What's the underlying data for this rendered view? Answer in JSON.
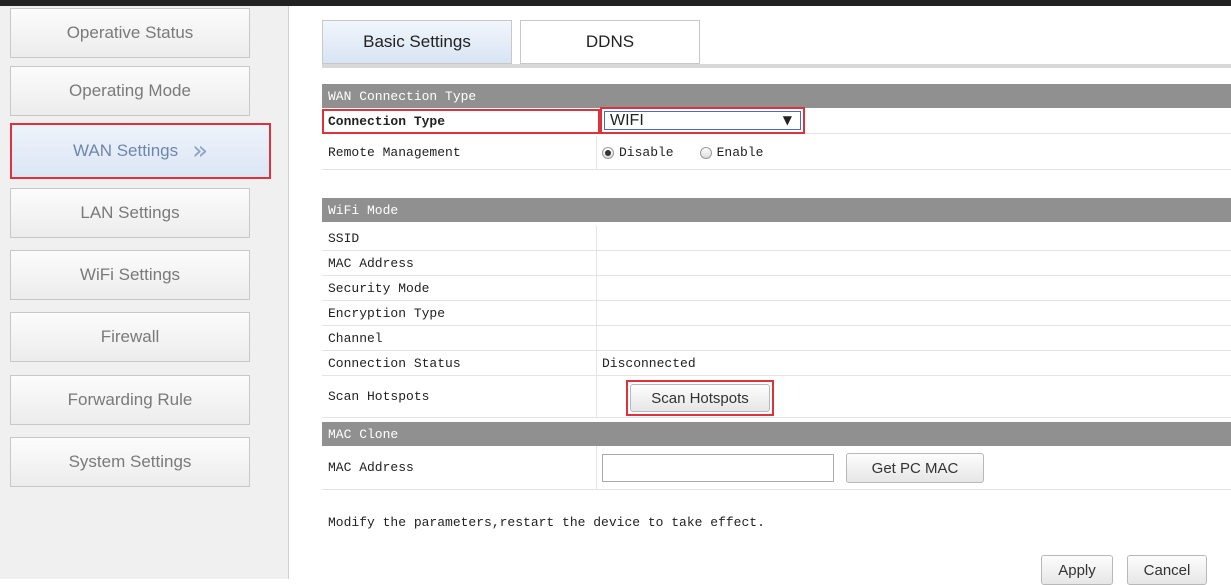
{
  "sidebar": {
    "items": [
      {
        "label": "Operative Status"
      },
      {
        "label": "Operating Mode"
      },
      {
        "label": "WAN Settings",
        "chevron": "»"
      },
      {
        "label": "LAN Settings"
      },
      {
        "label": "WiFi Settings"
      },
      {
        "label": "Firewall"
      },
      {
        "label": "Forwarding Rule"
      },
      {
        "label": "System Settings"
      }
    ]
  },
  "tabs": [
    {
      "label": "Basic Settings"
    },
    {
      "label": "DDNS"
    }
  ],
  "wan": {
    "header": "WAN Connection Type",
    "connection_type_label": "Connection Type",
    "connection_type_value": "WIFI",
    "remote_mgmt_label": "Remote Management",
    "remote_disable": "Disable",
    "remote_enable": "Enable"
  },
  "wifi": {
    "header": "WiFi Mode",
    "rows": [
      {
        "label": "SSID",
        "value": ""
      },
      {
        "label": "MAC Address",
        "value": ""
      },
      {
        "label": "Security Mode",
        "value": ""
      },
      {
        "label": "Encryption Type",
        "value": ""
      },
      {
        "label": "Channel",
        "value": ""
      },
      {
        "label": "Connection Status",
        "value": "Disconnected"
      }
    ],
    "scan_label": "Scan Hotspots",
    "scan_button": "Scan Hotspots"
  },
  "mac_clone": {
    "header": "MAC Clone",
    "label": "MAC Address",
    "input_value": "",
    "button": "Get PC MAC"
  },
  "note": "Modify the parameters,restart the device to take effect.",
  "actions": {
    "apply": "Apply",
    "cancel": "Cancel"
  },
  "colors": {
    "highlight": "#e0323c",
    "section_header": "#909090",
    "active_tab": "#d8e4f4"
  }
}
